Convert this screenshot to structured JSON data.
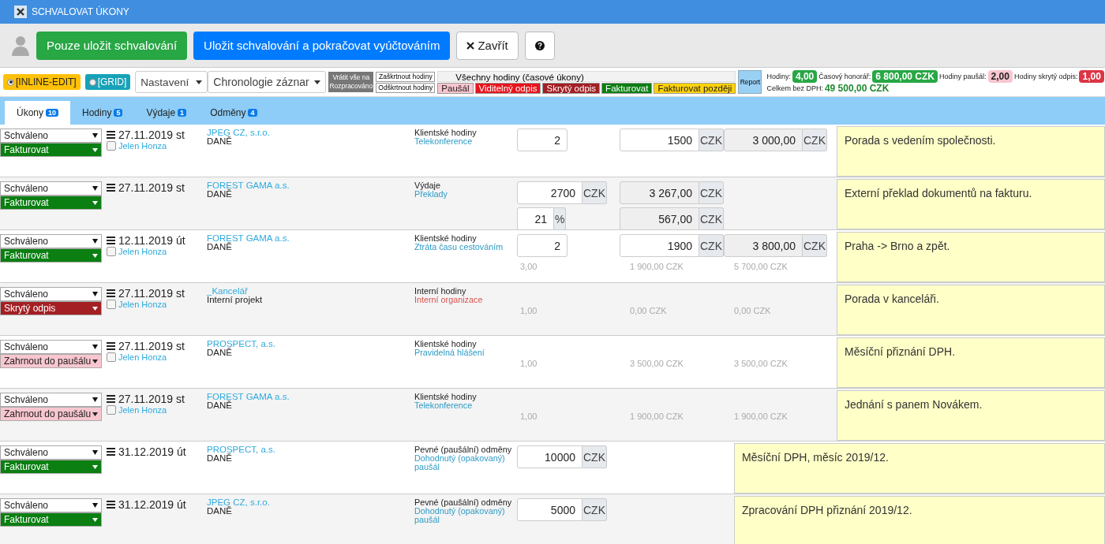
{
  "window": {
    "title": "SCHVALOVAT ÚKONY"
  },
  "toolbar": {
    "buttons": [
      {
        "label": "Pouze uložit schvalování",
        "kind": "success"
      },
      {
        "label": "Uložit schvalování a pokračovat vyúčtováním",
        "kind": "primary"
      },
      {
        "label": "Zavřít",
        "kind": "close"
      },
      {
        "kind": "help"
      }
    ]
  },
  "filters": {
    "modes": [
      {
        "label": "[INLINE-EDIT]",
        "selected": true,
        "color": "#ffc107"
      },
      {
        "label": "[GRID]",
        "selected": false,
        "color": "#17a2b8"
      }
    ],
    "settings": "Nastavení",
    "sort": "Chronologie záznar",
    "reset_button": "Vrátit vše na Rozpracováno",
    "check_buttons": [
      "Zaškrtnout hodiny",
      "Odškrtnout hodiny"
    ],
    "all_hours": "Všechny hodiny (časové úkony)",
    "categories": [
      {
        "label": "Paušál",
        "color": "#f8c6cf"
      },
      {
        "label": "Viditelný odpis",
        "color": "#e8141c"
      },
      {
        "label": "Skrytý odpis",
        "color": "#a31f24"
      },
      {
        "label": "Fakturovat",
        "color": "#0b7f12"
      },
      {
        "label": "Fakturovat později",
        "color": "#ffd30b"
      }
    ],
    "report_button": "Report"
  },
  "summary": {
    "items": [
      {
        "label": "Hodiny:",
        "value": "4,00",
        "color": "#28a745"
      },
      {
        "label": "Časový honorář:",
        "value": "6 800,00 CZK",
        "color": "#28a745"
      },
      {
        "label": "Hodiny paušál:",
        "value": "2,00",
        "color": "#f8c6cf"
      },
      {
        "label": "Hodiny skrytý odpis:",
        "value": "1,00",
        "color": "#dc3545"
      }
    ],
    "total_label": "Celkem bez DPH:",
    "total": "49 500,00 CZK"
  },
  "tabs": [
    {
      "label": "Úkony",
      "count": "10",
      "selected": true
    },
    {
      "label": "Hodiny",
      "count": "5",
      "selected": false
    },
    {
      "label": "Výdaje",
      "count": "1",
      "selected": false
    },
    {
      "label": "Odměny",
      "count": "4",
      "selected": false
    }
  ],
  "rows": [
    {
      "status": "Schváleno",
      "billing": {
        "label": "Fakturovat",
        "color": "#0b7f12"
      },
      "checked": false,
      "person": "Jelen Honza",
      "date": "27.11.2019 st",
      "client": "JPEG CZ, s.r.o.",
      "project": "DANĚ",
      "type": "Klientské hodiny",
      "activity": {
        "label": "Telekonference",
        "color": "#2e9bc6"
      },
      "kind": "hours",
      "values": {
        "quantity": "2",
        "rate": "1500",
        "rate_unit": "CZK",
        "total": "3 000,00",
        "total_unit": "CZK"
      },
      "note": "Porada s vedením společnosti."
    },
    {
      "status": "Schváleno",
      "billing": {
        "label": "Fakturovat",
        "color": "#0b7f12"
      },
      "date": "27.11.2019 st",
      "client": "FOREST GAMA a.s.",
      "project": "DANĚ",
      "type": "Výdaje",
      "activity": {
        "label": "Překlady",
        "color": "#2e9bc6"
      },
      "kind": "expense",
      "values": {
        "amount": "2700",
        "amount_unit": "CZK",
        "gross": "3 267,00",
        "gross_unit": "CZK",
        "vat": "21",
        "vat_unit": "%",
        "vat_amount": "567,00",
        "vat_amount_unit": "CZK"
      },
      "note": "Externí překlad dokumentů na fakturu."
    },
    {
      "status": "Schváleno",
      "billing": {
        "label": "Fakturovat",
        "color": "#0b7f12"
      },
      "checked": false,
      "person": "Jelen Honza",
      "date": "12.11.2019 út",
      "client": "FOREST GAMA a.s.",
      "project": "DANĚ",
      "type": "Klientské hodiny",
      "activity": {
        "label": "Ztráta času cestováním",
        "color": "#2e9bc6"
      },
      "kind": "hours",
      "values": {
        "quantity": "2",
        "rate": "1900",
        "rate_unit": "CZK",
        "total": "3 800,00",
        "total_unit": "CZK",
        "summary": [
          "3,00",
          "1 900,00 CZK",
          "5 700,00 CZK"
        ]
      },
      "note": "Praha -> Brno a zpět."
    },
    {
      "status": "Schváleno",
      "billing": {
        "label": "Skrytý odpis",
        "color": "#a31f24"
      },
      "checked": false,
      "person": "Jelen Honza",
      "date": "27.11.2019 st",
      "client": "_Kancelář",
      "project": "Interní projekt",
      "type": "Interní hodiny",
      "activity": {
        "label": "Interní organizace",
        "color": "#d9534f"
      },
      "kind": "summary",
      "values": {
        "summary": [
          "1,00",
          "0,00 CZK",
          "0,00 CZK"
        ]
      },
      "note": "Porada v kanceláři."
    },
    {
      "status": "Schváleno",
      "billing": {
        "label": "Zahrnout do paušálu",
        "color": "#f8c6cf"
      },
      "checked": false,
      "person": "Jelen Honza",
      "date": "27.11.2019 st",
      "client": "PROSPECT, a.s.",
      "project": "DANĚ",
      "type": "Klientské hodiny",
      "activity": {
        "label": "Pravidelná hlášení",
        "color": "#2e9bc6"
      },
      "kind": "summary",
      "values": {
        "summary": [
          "1,00",
          "3 500,00 CZK",
          "3 500,00 CZK"
        ]
      },
      "note": "Měsíční přiznání DPH."
    },
    {
      "status": "Schváleno",
      "billing": {
        "label": "Zahrnout do paušálu",
        "color": "#f8c6cf"
      },
      "checked": false,
      "person": "Jelen Honza",
      "date": "27.11.2019 st",
      "client": "FOREST GAMA a.s.",
      "project": "DANĚ",
      "type": "Klientské hodiny",
      "activity": {
        "label": "Telekonference",
        "color": "#2e9bc6"
      },
      "kind": "summary",
      "values": {
        "summary": [
          "1,00",
          "1 900,00 CZK",
          "1 900,00 CZK"
        ]
      },
      "note": "Jednání s panem Novákem."
    },
    {
      "status": "Schváleno",
      "billing": {
        "label": "Fakturovat",
        "color": "#0b7f12"
      },
      "date": "31.12.2019 út",
      "client": "PROSPECT, a.s.",
      "project": "DANĚ",
      "type": "Pevné (paušální) odměny",
      "activity": {
        "label": "Dohodnutý (opakovaný) paušál",
        "color": "#2e9bc6"
      },
      "kind": "fixed",
      "values": {
        "amount": "10000",
        "amount_unit": "CZK"
      },
      "note": "Měsíční DPH, měsíc 2019/12."
    },
    {
      "status": "Schváleno",
      "billing": {
        "label": "Fakturovat",
        "color": "#0b7f12"
      },
      "date": "31.12.2019 út",
      "client": "JPEG CZ, s.r.o.",
      "project": "DANĚ",
      "type": "Pevné (paušální) odměny",
      "activity": {
        "label": "Dohodnutý (opakovaný) paušál",
        "color": "#2e9bc6"
      },
      "kind": "fixed",
      "values": {
        "amount": "5000",
        "amount_unit": "CZK"
      },
      "note": "Zpracování DPH přiznání 2019/12."
    }
  ]
}
